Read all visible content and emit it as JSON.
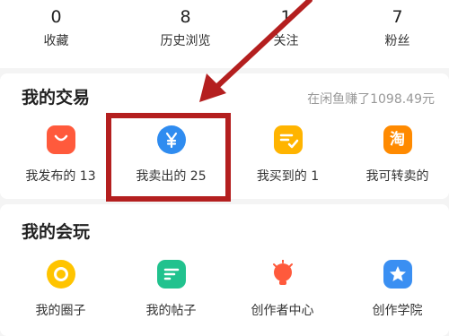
{
  "stats": [
    {
      "value": "0",
      "label": "收藏"
    },
    {
      "value": "8",
      "label": "历史浏览"
    },
    {
      "value": "1",
      "label": "关注"
    },
    {
      "value": "7",
      "label": "粉丝"
    }
  ],
  "trade": {
    "title": "我的交易",
    "earnings_text": "在闲鱼赚了1098.49元",
    "items": [
      {
        "label": "我发布的 13",
        "icon": "shopping-bag-icon",
        "color": "#ff5a3c"
      },
      {
        "label": "我卖出的 25",
        "icon": "yen-icon",
        "color": "#2f8cf0"
      },
      {
        "label": "我买到的 1",
        "icon": "checklist-icon",
        "color": "#ffb400"
      },
      {
        "label": "我可转卖的",
        "icon": "tao-icon",
        "color": "#ff8a00",
        "glyph": "淘"
      }
    ]
  },
  "play": {
    "title": "我的会玩",
    "items": [
      {
        "label": "我的圈子",
        "icon": "circle-icon",
        "color": "#ffc400"
      },
      {
        "label": "我的帖子",
        "icon": "post-icon",
        "color": "#21c28e"
      },
      {
        "label": "创作者中心",
        "icon": "bulb-icon",
        "color": "#ff5a3c"
      },
      {
        "label": "创作学院",
        "icon": "star-icon",
        "color": "#3a8ff2"
      }
    ]
  },
  "colors": {
    "annotation_red": "#b41f1f"
  }
}
